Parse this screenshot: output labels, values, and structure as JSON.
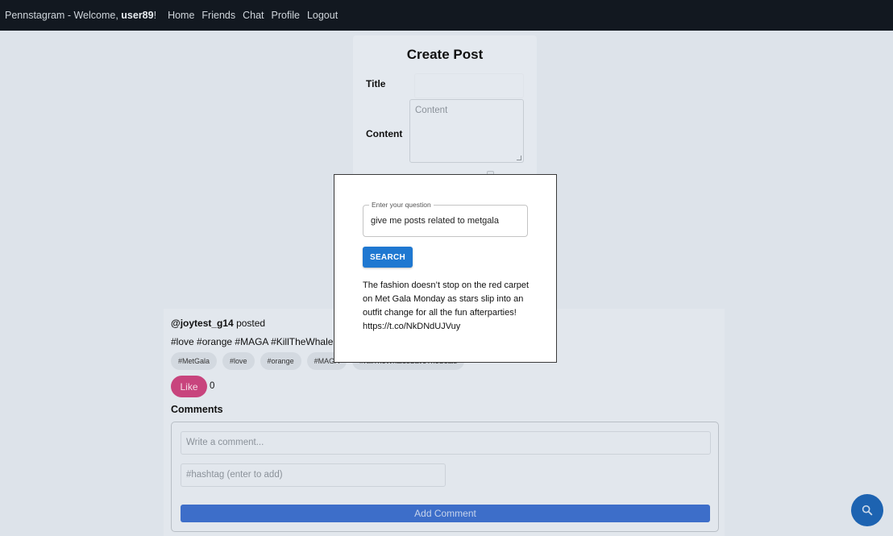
{
  "navbar": {
    "brand_prefix": "Pennstagram - Welcome, ",
    "username": "user89",
    "brand_suffix": "!",
    "links": [
      "Home",
      "Friends",
      "Chat",
      "Profile",
      "Logout"
    ]
  },
  "create_post": {
    "title": "Create Post",
    "title_label": "Title",
    "content_label": "Content",
    "content_placeholder": "Content"
  },
  "post": {
    "author": "@joytest_g14",
    "posted_word": " posted",
    "content": "#love #orange #MAGA #KillTheWhalesS",
    "tags": [
      "#MetGala",
      "#love",
      "#orange",
      "#MAGA",
      "#KillTheWhalesSaveTheSeals"
    ],
    "like_label": "Like",
    "like_count": "0"
  },
  "comments": {
    "heading": "Comments",
    "comment_placeholder": "Write a comment...",
    "hashtag_placeholder": "#hashtag (enter to add)",
    "add_button": "Add Comment"
  },
  "modal": {
    "question_label": "Enter your question",
    "question_value": "give me posts related to metgala",
    "search_button": "SEARCH",
    "answer": "The fashion doesn’t stop on the red carpet on Met Gala Monday as stars slip into an outfit change for all the fun afterparties! https://t.co/NkDNdUJVuy"
  },
  "colors": {
    "navbar_bg": "#121820",
    "like_pink": "#c8447d",
    "primary_blue": "#1f78d1",
    "fab_blue": "#1d63b1"
  },
  "icons": {
    "fab": "search-icon"
  }
}
